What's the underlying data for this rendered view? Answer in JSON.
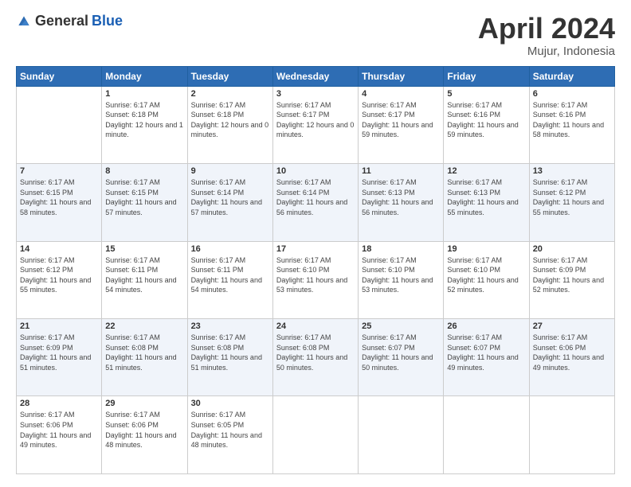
{
  "header": {
    "logo_general": "General",
    "logo_blue": "Blue",
    "title": "April 2024",
    "location": "Mujur, Indonesia"
  },
  "days_of_week": [
    "Sunday",
    "Monday",
    "Tuesday",
    "Wednesday",
    "Thursday",
    "Friday",
    "Saturday"
  ],
  "weeks": [
    [
      {
        "day": "",
        "sunrise": "",
        "sunset": "",
        "daylight": "",
        "empty": true
      },
      {
        "day": "1",
        "sunrise": "Sunrise: 6:17 AM",
        "sunset": "Sunset: 6:18 PM",
        "daylight": "Daylight: 12 hours and 1 minute.",
        "empty": false
      },
      {
        "day": "2",
        "sunrise": "Sunrise: 6:17 AM",
        "sunset": "Sunset: 6:18 PM",
        "daylight": "Daylight: 12 hours and 0 minutes.",
        "empty": false
      },
      {
        "day": "3",
        "sunrise": "Sunrise: 6:17 AM",
        "sunset": "Sunset: 6:17 PM",
        "daylight": "Daylight: 12 hours and 0 minutes.",
        "empty": false
      },
      {
        "day": "4",
        "sunrise": "Sunrise: 6:17 AM",
        "sunset": "Sunset: 6:17 PM",
        "daylight": "Daylight: 11 hours and 59 minutes.",
        "empty": false
      },
      {
        "day": "5",
        "sunrise": "Sunrise: 6:17 AM",
        "sunset": "Sunset: 6:16 PM",
        "daylight": "Daylight: 11 hours and 59 minutes.",
        "empty": false
      },
      {
        "day": "6",
        "sunrise": "Sunrise: 6:17 AM",
        "sunset": "Sunset: 6:16 PM",
        "daylight": "Daylight: 11 hours and 58 minutes.",
        "empty": false
      }
    ],
    [
      {
        "day": "7",
        "sunrise": "Sunrise: 6:17 AM",
        "sunset": "Sunset: 6:15 PM",
        "daylight": "Daylight: 11 hours and 58 minutes.",
        "empty": false
      },
      {
        "day": "8",
        "sunrise": "Sunrise: 6:17 AM",
        "sunset": "Sunset: 6:15 PM",
        "daylight": "Daylight: 11 hours and 57 minutes.",
        "empty": false
      },
      {
        "day": "9",
        "sunrise": "Sunrise: 6:17 AM",
        "sunset": "Sunset: 6:14 PM",
        "daylight": "Daylight: 11 hours and 57 minutes.",
        "empty": false
      },
      {
        "day": "10",
        "sunrise": "Sunrise: 6:17 AM",
        "sunset": "Sunset: 6:14 PM",
        "daylight": "Daylight: 11 hours and 56 minutes.",
        "empty": false
      },
      {
        "day": "11",
        "sunrise": "Sunrise: 6:17 AM",
        "sunset": "Sunset: 6:13 PM",
        "daylight": "Daylight: 11 hours and 56 minutes.",
        "empty": false
      },
      {
        "day": "12",
        "sunrise": "Sunrise: 6:17 AM",
        "sunset": "Sunset: 6:13 PM",
        "daylight": "Daylight: 11 hours and 55 minutes.",
        "empty": false
      },
      {
        "day": "13",
        "sunrise": "Sunrise: 6:17 AM",
        "sunset": "Sunset: 6:12 PM",
        "daylight": "Daylight: 11 hours and 55 minutes.",
        "empty": false
      }
    ],
    [
      {
        "day": "14",
        "sunrise": "Sunrise: 6:17 AM",
        "sunset": "Sunset: 6:12 PM",
        "daylight": "Daylight: 11 hours and 55 minutes.",
        "empty": false
      },
      {
        "day": "15",
        "sunrise": "Sunrise: 6:17 AM",
        "sunset": "Sunset: 6:11 PM",
        "daylight": "Daylight: 11 hours and 54 minutes.",
        "empty": false
      },
      {
        "day": "16",
        "sunrise": "Sunrise: 6:17 AM",
        "sunset": "Sunset: 6:11 PM",
        "daylight": "Daylight: 11 hours and 54 minutes.",
        "empty": false
      },
      {
        "day": "17",
        "sunrise": "Sunrise: 6:17 AM",
        "sunset": "Sunset: 6:10 PM",
        "daylight": "Daylight: 11 hours and 53 minutes.",
        "empty": false
      },
      {
        "day": "18",
        "sunrise": "Sunrise: 6:17 AM",
        "sunset": "Sunset: 6:10 PM",
        "daylight": "Daylight: 11 hours and 53 minutes.",
        "empty": false
      },
      {
        "day": "19",
        "sunrise": "Sunrise: 6:17 AM",
        "sunset": "Sunset: 6:10 PM",
        "daylight": "Daylight: 11 hours and 52 minutes.",
        "empty": false
      },
      {
        "day": "20",
        "sunrise": "Sunrise: 6:17 AM",
        "sunset": "Sunset: 6:09 PM",
        "daylight": "Daylight: 11 hours and 52 minutes.",
        "empty": false
      }
    ],
    [
      {
        "day": "21",
        "sunrise": "Sunrise: 6:17 AM",
        "sunset": "Sunset: 6:09 PM",
        "daylight": "Daylight: 11 hours and 51 minutes.",
        "empty": false
      },
      {
        "day": "22",
        "sunrise": "Sunrise: 6:17 AM",
        "sunset": "Sunset: 6:08 PM",
        "daylight": "Daylight: 11 hours and 51 minutes.",
        "empty": false
      },
      {
        "day": "23",
        "sunrise": "Sunrise: 6:17 AM",
        "sunset": "Sunset: 6:08 PM",
        "daylight": "Daylight: 11 hours and 51 minutes.",
        "empty": false
      },
      {
        "day": "24",
        "sunrise": "Sunrise: 6:17 AM",
        "sunset": "Sunset: 6:08 PM",
        "daylight": "Daylight: 11 hours and 50 minutes.",
        "empty": false
      },
      {
        "day": "25",
        "sunrise": "Sunrise: 6:17 AM",
        "sunset": "Sunset: 6:07 PM",
        "daylight": "Daylight: 11 hours and 50 minutes.",
        "empty": false
      },
      {
        "day": "26",
        "sunrise": "Sunrise: 6:17 AM",
        "sunset": "Sunset: 6:07 PM",
        "daylight": "Daylight: 11 hours and 49 minutes.",
        "empty": false
      },
      {
        "day": "27",
        "sunrise": "Sunrise: 6:17 AM",
        "sunset": "Sunset: 6:06 PM",
        "daylight": "Daylight: 11 hours and 49 minutes.",
        "empty": false
      }
    ],
    [
      {
        "day": "28",
        "sunrise": "Sunrise: 6:17 AM",
        "sunset": "Sunset: 6:06 PM",
        "daylight": "Daylight: 11 hours and 49 minutes.",
        "empty": false
      },
      {
        "day": "29",
        "sunrise": "Sunrise: 6:17 AM",
        "sunset": "Sunset: 6:06 PM",
        "daylight": "Daylight: 11 hours and 48 minutes.",
        "empty": false
      },
      {
        "day": "30",
        "sunrise": "Sunrise: 6:17 AM",
        "sunset": "Sunset: 6:05 PM",
        "daylight": "Daylight: 11 hours and 48 minutes.",
        "empty": false
      },
      {
        "day": "",
        "sunrise": "",
        "sunset": "",
        "daylight": "",
        "empty": true
      },
      {
        "day": "",
        "sunrise": "",
        "sunset": "",
        "daylight": "",
        "empty": true
      },
      {
        "day": "",
        "sunrise": "",
        "sunset": "",
        "daylight": "",
        "empty": true
      },
      {
        "day": "",
        "sunrise": "",
        "sunset": "",
        "daylight": "",
        "empty": true
      }
    ]
  ]
}
